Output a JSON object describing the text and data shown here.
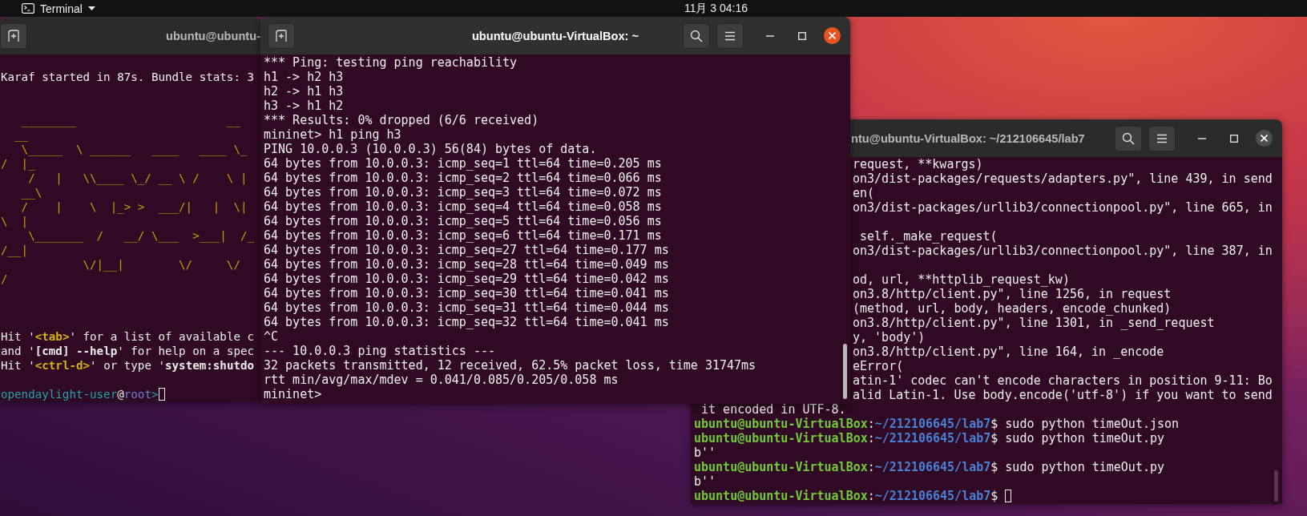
{
  "top_bar": {
    "app_menu": "Terminal",
    "clock": "11月 3 04:16"
  },
  "windows": [
    {
      "title": "ubuntu@ubuntu-",
      "focused": false,
      "buttons": [
        {
          "kind": "new_tab"
        }
      ],
      "lines": [
        {
          "kind": "blank"
        },
        {
          "kind": "plain",
          "text": "Karaf started in 87s. Bundle stats: 3"
        },
        {
          "kind": "blank"
        },
        {
          "kind": "blank"
        },
        {
          "kind": "art",
          "text": "   ________                      __"
        },
        {
          "kind": "art",
          "text": "  __"
        },
        {
          "kind": "art",
          "text": "   \\_____  \\ ______   ____   ____ \\_"
        },
        {
          "kind": "art",
          "text": "/  |_"
        },
        {
          "kind": "art",
          "text": "    /   |   \\\\____ \\_/ __ \\ /    \\ |"
        },
        {
          "kind": "art",
          "text": "   __\\"
        },
        {
          "kind": "art",
          "text": "   /    |    \\  |_> >  ___/|   |  \\|"
        },
        {
          "kind": "art",
          "text": "\\  |"
        },
        {
          "kind": "art",
          "text": "    \\_______  /   __/ \\___  >___|  /_"
        },
        {
          "kind": "art",
          "text": "/__|"
        },
        {
          "kind": "art",
          "text": "            \\/|__|        \\/     \\/"
        },
        {
          "kind": "art",
          "text": "/"
        },
        {
          "kind": "blank"
        },
        {
          "kind": "blank"
        },
        {
          "kind": "blank"
        },
        {
          "kind": "styled",
          "segments": [
            {
              "kind": "plain",
              "text": "Hit '"
            },
            {
              "kind": "accent",
              "text": "<tab>"
            },
            {
              "kind": "plain",
              "text": "' for a list of available c"
            }
          ]
        },
        {
          "kind": "styled",
          "segments": [
            {
              "kind": "plain",
              "text": "and '"
            },
            {
              "kind": "bold",
              "text": "[cmd] --help"
            },
            {
              "kind": "plain",
              "text": "' for help on a spec"
            }
          ]
        },
        {
          "kind": "styled",
          "segments": [
            {
              "kind": "plain",
              "text": "Hit '"
            },
            {
              "kind": "accent",
              "text": "<ctrl-d>"
            },
            {
              "kind": "plain",
              "text": "' or type '"
            },
            {
              "kind": "bold",
              "text": "system:shutdo"
            }
          ]
        },
        {
          "kind": "blank"
        },
        {
          "kind": "styled",
          "cursor": true,
          "segments": [
            {
              "kind": "teal",
              "text": "opendaylight-user"
            },
            {
              "kind": "plain",
              "text": "@"
            },
            {
              "kind": "host",
              "text": "root"
            },
            {
              "kind": "teal",
              "text": ">"
            }
          ]
        }
      ]
    },
    {
      "title": "ubuntu@ubuntu-VirtualBox: ~",
      "focused": true,
      "buttons": [
        {
          "kind": "new_tab"
        },
        {
          "kind": "search"
        },
        {
          "kind": "menu"
        },
        {
          "kind": "minimize"
        },
        {
          "kind": "maximize"
        },
        {
          "kind": "close"
        }
      ],
      "lines": [
        {
          "kind": "plain",
          "text": "*** Ping: testing ping reachability"
        },
        {
          "kind": "plain",
          "text": "h1 -> h2 h3"
        },
        {
          "kind": "plain",
          "text": "h2 -> h1 h3"
        },
        {
          "kind": "plain",
          "text": "h3 -> h1 h2"
        },
        {
          "kind": "plain",
          "text": "*** Results: 0% dropped (6/6 received)"
        },
        {
          "kind": "plain",
          "text": "mininet> h1 ping h3"
        },
        {
          "kind": "plain",
          "text": "PING 10.0.0.3 (10.0.0.3) 56(84) bytes of data."
        },
        {
          "kind": "plain",
          "text": "64 bytes from 10.0.0.3: icmp_seq=1 ttl=64 time=0.205 ms"
        },
        {
          "kind": "plain",
          "text": "64 bytes from 10.0.0.3: icmp_seq=2 ttl=64 time=0.066 ms"
        },
        {
          "kind": "plain",
          "text": "64 bytes from 10.0.0.3: icmp_seq=3 ttl=64 time=0.072 ms"
        },
        {
          "kind": "plain",
          "text": "64 bytes from 10.0.0.3: icmp_seq=4 ttl=64 time=0.058 ms"
        },
        {
          "kind": "plain",
          "text": "64 bytes from 10.0.0.3: icmp_seq=5 ttl=64 time=0.056 ms"
        },
        {
          "kind": "plain",
          "text": "64 bytes from 10.0.0.3: icmp_seq=6 ttl=64 time=0.171 ms"
        },
        {
          "kind": "plain",
          "text": "64 bytes from 10.0.0.3: icmp_seq=27 ttl=64 time=0.177 ms"
        },
        {
          "kind": "plain",
          "text": "64 bytes from 10.0.0.3: icmp_seq=28 ttl=64 time=0.049 ms"
        },
        {
          "kind": "plain",
          "text": "64 bytes from 10.0.0.3: icmp_seq=29 ttl=64 time=0.042 ms"
        },
        {
          "kind": "plain",
          "text": "64 bytes from 10.0.0.3: icmp_seq=30 ttl=64 time=0.041 ms"
        },
        {
          "kind": "plain",
          "text": "64 bytes from 10.0.0.3: icmp_seq=31 ttl=64 time=0.044 ms"
        },
        {
          "kind": "plain",
          "text": "64 bytes from 10.0.0.3: icmp_seq=32 ttl=64 time=0.041 ms"
        },
        {
          "kind": "plain",
          "text": "^C"
        },
        {
          "kind": "plain",
          "text": "--- 10.0.0.3 ping statistics ---"
        },
        {
          "kind": "plain",
          "text": "32 packets transmitted, 12 received, 62.5% packet loss, time 31747ms"
        },
        {
          "kind": "plain",
          "text": "rtt min/avg/max/mdev = 0.041/0.085/0.205/0.058 ms"
        },
        {
          "kind": "plain",
          "text": "mininet>"
        }
      ]
    },
    {
      "title": "ntu@ubuntu-VirtualBox: ~/212106645/lab7",
      "focused": false,
      "buttons": [
        {
          "kind": "search"
        },
        {
          "kind": "menu"
        },
        {
          "kind": "minimize"
        },
        {
          "kind": "maximize"
        },
        {
          "kind": "close"
        }
      ],
      "partly_hidden_lines": [
        {
          "kind": "plain",
          "text": "request, **kwargs)"
        },
        {
          "kind": "plain",
          "text": "on3/dist-packages/requests/adapters.py\", line 439, in send"
        },
        {
          "kind": "plain",
          "text": "en("
        },
        {
          "kind": "plain",
          "text": "on3/dist-packages/urllib3/connectionpool.py\", line 665, in"
        },
        {
          "kind": "blank"
        },
        {
          "kind": "plain",
          "text": " self._make_request("
        },
        {
          "kind": "plain",
          "text": "on3/dist-packages/urllib3/connectionpool.py\", line 387, in"
        },
        {
          "kind": "blank"
        },
        {
          "kind": "plain",
          "text": "od, url, **httplib_request_kw)"
        },
        {
          "kind": "plain",
          "text": "on3.8/http/client.py\", line 1256, in request"
        },
        {
          "kind": "plain",
          "text": "(method, url, body, headers, encode_chunked)"
        },
        {
          "kind": "plain",
          "text": "on3.8/http/client.py\", line 1301, in _send_request"
        },
        {
          "kind": "plain",
          "text": "y, 'body')"
        },
        {
          "kind": "plain",
          "text": "on3.8/http/client.py\", line 164, in _encode"
        },
        {
          "kind": "plain",
          "text": "eError("
        },
        {
          "kind": "plain",
          "text": "atin-1' codec can't encode characters in position 9-11: Bo"
        },
        {
          "kind": "plain",
          "text": "alid Latin-1. Use body.encode('utf-8') if you want to send"
        }
      ],
      "lines": [
        {
          "kind": "plain",
          "text": " it encoded in UTF-8."
        },
        {
          "kind": "styled",
          "segments": [
            {
              "kind": "user",
              "text": "ubuntu@ubuntu-VirtualBox"
            },
            {
              "kind": "plain",
              "text": ":"
            },
            {
              "kind": "path",
              "text": "~/212106645/lab7"
            },
            {
              "kind": "plain",
              "text": "$ sudo python timeOut.json"
            }
          ]
        },
        {
          "kind": "styled",
          "segments": [
            {
              "kind": "user",
              "text": "ubuntu@ubuntu-VirtualBox"
            },
            {
              "kind": "plain",
              "text": ":"
            },
            {
              "kind": "path",
              "text": "~/212106645/lab7"
            },
            {
              "kind": "plain",
              "text": "$ sudo python timeOut.py"
            }
          ]
        },
        {
          "kind": "plain",
          "text": "b''"
        },
        {
          "kind": "styled",
          "segments": [
            {
              "kind": "user",
              "text": "ubuntu@ubuntu-VirtualBox"
            },
            {
              "kind": "plain",
              "text": ":"
            },
            {
              "kind": "path",
              "text": "~/212106645/lab7"
            },
            {
              "kind": "plain",
              "text": "$ sudo python timeOut.py"
            }
          ]
        },
        {
          "kind": "plain",
          "text": "b''"
        },
        {
          "kind": "styled",
          "cursor": true,
          "segments": [
            {
              "kind": "user",
              "text": "ubuntu@ubuntu-VirtualBox"
            },
            {
              "kind": "plain",
              "text": ":"
            },
            {
              "kind": "path",
              "text": "~/212106645/lab7"
            },
            {
              "kind": "plain",
              "text": "$"
            }
          ]
        }
      ]
    }
  ]
}
